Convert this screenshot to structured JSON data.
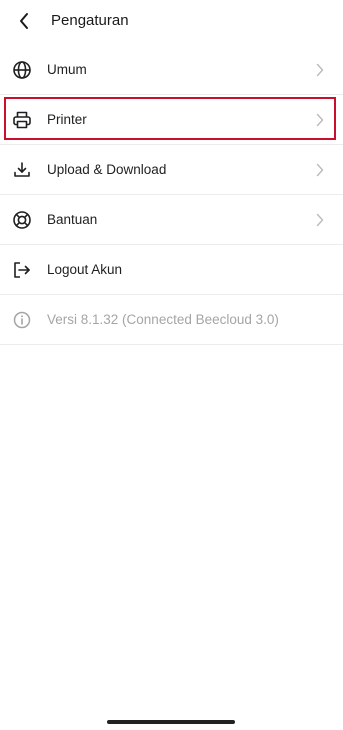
{
  "header": {
    "title": "Pengaturan",
    "back_icon": "chevron-left-icon"
  },
  "menu": {
    "items": [
      {
        "label": "Umum",
        "icon": "globe-icon",
        "has_chevron": true
      },
      {
        "label": "Printer",
        "icon": "printer-icon",
        "has_chevron": true,
        "highlighted": true
      },
      {
        "label": "Upload & Download",
        "icon": "download-icon",
        "has_chevron": true
      },
      {
        "label": "Bantuan",
        "icon": "lifebuoy-icon",
        "has_chevron": true
      },
      {
        "label": "Logout Akun",
        "icon": "logout-icon",
        "has_chevron": false
      },
      {
        "label": "Versi 8.1.32 (Connected Beecloud 3.0)",
        "icon": "info-icon",
        "has_chevron": false
      }
    ]
  },
  "colors": {
    "highlight": "#c8102e",
    "text": "#1f1f1f",
    "muted": "#a5a5a5",
    "chevron": "#bdbdbd",
    "divider": "#ececec"
  }
}
